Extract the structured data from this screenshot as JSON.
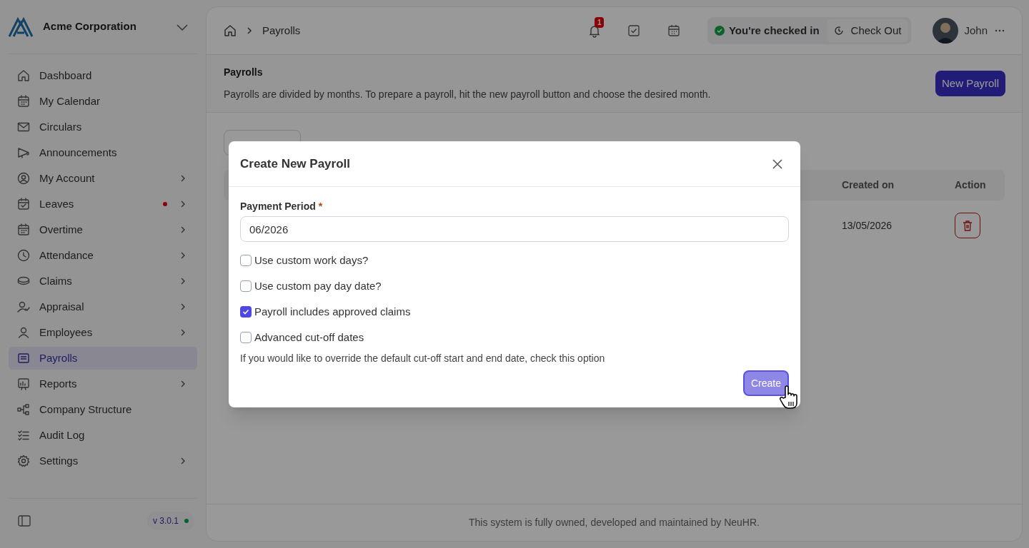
{
  "sidebar": {
    "company": "Acme Corporation",
    "items": [
      {
        "label": "Dashboard",
        "has_submenu": false,
        "dot": false,
        "selected": false
      },
      {
        "label": "My Calendar",
        "has_submenu": false,
        "dot": false,
        "selected": false
      },
      {
        "label": "Circulars",
        "has_submenu": false,
        "dot": false,
        "selected": false
      },
      {
        "label": "Announcements",
        "has_submenu": false,
        "dot": false,
        "selected": false
      },
      {
        "label": "My Account",
        "has_submenu": true,
        "dot": false,
        "selected": false
      },
      {
        "label": "Leaves",
        "has_submenu": true,
        "dot": true,
        "selected": false
      },
      {
        "label": "Overtime",
        "has_submenu": true,
        "dot": false,
        "selected": false
      },
      {
        "label": "Attendance",
        "has_submenu": true,
        "dot": false,
        "selected": false
      },
      {
        "label": "Claims",
        "has_submenu": true,
        "dot": false,
        "selected": false
      },
      {
        "label": "Appraisal",
        "has_submenu": true,
        "dot": false,
        "selected": false
      },
      {
        "label": "Employees",
        "has_submenu": true,
        "dot": false,
        "selected": false
      },
      {
        "label": "Payrolls",
        "has_submenu": false,
        "dot": false,
        "selected": true
      },
      {
        "label": "Reports",
        "has_submenu": true,
        "dot": false,
        "selected": false
      },
      {
        "label": "Company Structure",
        "has_submenu": false,
        "dot": false,
        "selected": false
      },
      {
        "label": "Audit Log",
        "has_submenu": false,
        "dot": false,
        "selected": false
      },
      {
        "label": "Settings",
        "has_submenu": true,
        "dot": false,
        "selected": false
      }
    ],
    "version": "v 3.0.1"
  },
  "header": {
    "breadcrumb": [
      "Payrolls"
    ],
    "notification_count": "1",
    "check_status": "You're checked in",
    "check_out": "Check Out",
    "user": "John"
  },
  "page": {
    "title": "Payrolls",
    "description": "Payrolls are divided by months. To prepare a payroll, hit the new payroll button and choose the desired month.",
    "new_button": "New Payroll"
  },
  "table": {
    "columns": [
      "Created on",
      "Action"
    ],
    "rows": [
      {
        "created_on": "13/05/2026"
      }
    ]
  },
  "footer": "This system is fully owned, developed and maintained by NeuHR.",
  "modal": {
    "title": "Create New Payroll",
    "field_label": "Payment Period",
    "required_mark": "*",
    "value": "06/2026",
    "options": [
      {
        "label": "Use custom work days?",
        "checked": false
      },
      {
        "label": "Use custom pay day date?",
        "checked": false
      },
      {
        "label": "Payroll includes approved claims",
        "checked": true
      },
      {
        "label": "Advanced cut-off dates",
        "checked": false
      }
    ],
    "help": "If you would like to override the default cut-off start and end date, check this option",
    "submit": "Create"
  }
}
